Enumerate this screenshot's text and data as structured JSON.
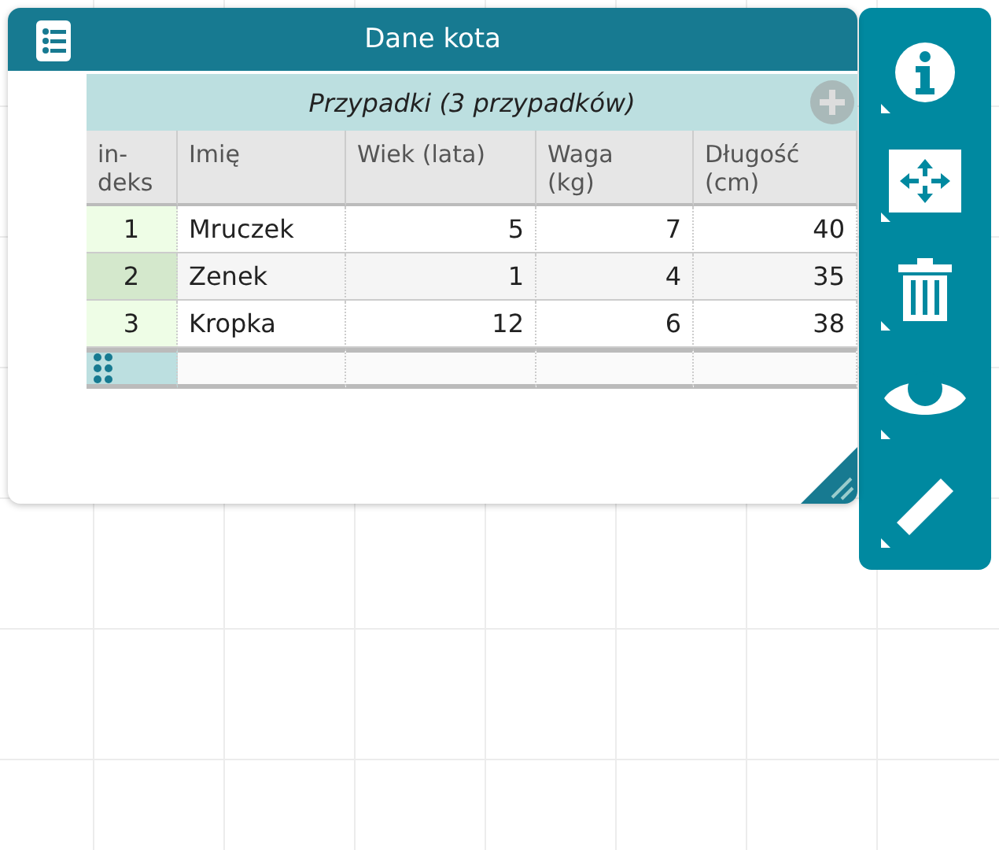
{
  "window": {
    "title": "Dane kota"
  },
  "table": {
    "title": "Przypadki (3 przypadków)",
    "columns": [
      "in-\ndeks",
      "Imię",
      "Wiek (lata)",
      "Waga\n(kg)",
      "Długość\n(cm)"
    ],
    "rows": [
      {
        "selected": false,
        "cells": [
          "1",
          "Mruczek",
          "5",
          "7",
          "40"
        ]
      },
      {
        "selected": true,
        "cells": [
          "2",
          "Zenek",
          "1",
          "4",
          "35"
        ]
      },
      {
        "selected": false,
        "cells": [
          "3",
          "Kropka",
          "12",
          "6",
          "38"
        ]
      }
    ]
  },
  "toolbar": [
    {
      "kind": "info"
    },
    {
      "kind": "scale"
    },
    {
      "kind": "trash"
    },
    {
      "kind": "hide"
    },
    {
      "kind": "ruler"
    }
  ]
}
